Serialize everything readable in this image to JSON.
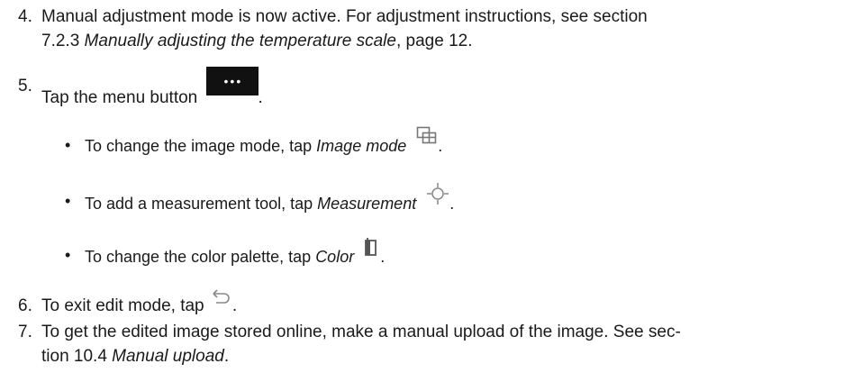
{
  "steps": {
    "s4": {
      "num": "4.",
      "line1": "Manual adjustment mode is now active. For adjustment instructions, see section",
      "line2_pre": "7.2.3 ",
      "line2_italic": "Manually adjusting the temperature scale",
      "line2_post": ", page 12."
    },
    "s5": {
      "num": "5.",
      "text": "Tap the menu button",
      "post": ".",
      "menu_button_glyph": "•••"
    },
    "s6": {
      "num": "6.",
      "text": "To exit edit mode, tap",
      "post": "."
    },
    "s7": {
      "num": "7.",
      "line1": "To get the edited image stored online, make a manual upload of the image. See sec-",
      "line2_pre": "tion 10.4 ",
      "line2_italic": "Manual upload",
      "line2_post": "."
    }
  },
  "bullets": [
    {
      "dot": "•",
      "text": "To change the image mode, tap ",
      "italic": "Image mode",
      "icon": "image-mode-icon",
      "post": "."
    },
    {
      "dot": "•",
      "text": "To add a measurement tool, tap ",
      "italic": "Measurement",
      "icon": "measurement-icon",
      "post": "."
    },
    {
      "dot": "•",
      "text": "To change the color palette, tap ",
      "italic": "Color",
      "icon": "color-palette-icon",
      "post": "."
    }
  ],
  "colors": {
    "text": "#1a1a1a",
    "menu_button_bg": "#111111",
    "icon_stroke": "#777777"
  }
}
